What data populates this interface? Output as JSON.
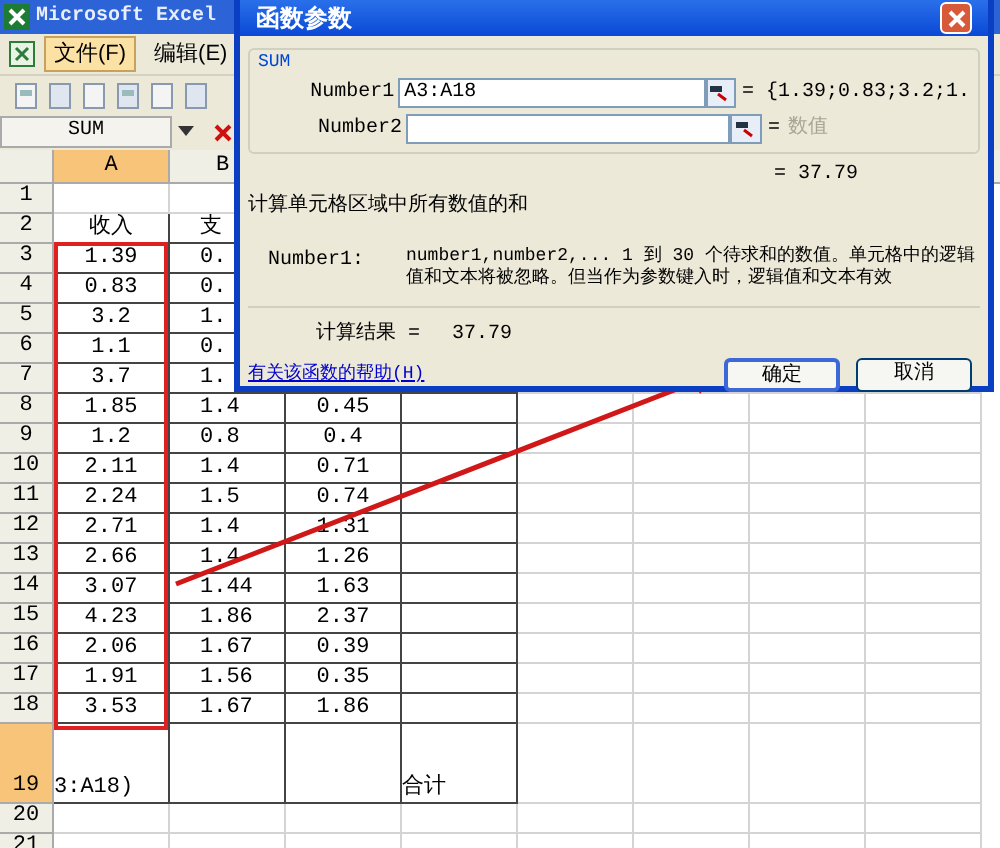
{
  "excel": {
    "title": "Microsoft Excel",
    "menus": [
      {
        "label": "文件(F)",
        "selected": true
      },
      {
        "label": "编辑(E)",
        "selected": false
      }
    ],
    "name_box": "SUM",
    "columns": [
      {
        "label": "A",
        "selected": true
      },
      {
        "label": "B",
        "selected": false
      }
    ],
    "rows": [
      {
        "header": "1",
        "selected": false,
        "cells": [
          null,
          null,
          null,
          null
        ]
      },
      {
        "header": "2",
        "selected": false,
        "cells": [
          "收入",
          "支",
          null,
          null
        ]
      },
      {
        "header": "3",
        "selected": false,
        "cells": [
          "1.39",
          "0.",
          null,
          null
        ]
      },
      {
        "header": "4",
        "selected": false,
        "cells": [
          "0.83",
          "0.",
          null,
          null
        ]
      },
      {
        "header": "5",
        "selected": false,
        "cells": [
          "3.2",
          "1.",
          null,
          null
        ]
      },
      {
        "header": "6",
        "selected": false,
        "cells": [
          "1.1",
          "0.",
          null,
          null
        ]
      },
      {
        "header": "7",
        "selected": false,
        "cells": [
          "3.7",
          "1.",
          null,
          null
        ]
      },
      {
        "header": "8",
        "selected": false,
        "cells": [
          "1.85",
          "1.4",
          "0.45",
          null
        ]
      },
      {
        "header": "9",
        "selected": false,
        "cells": [
          "1.2",
          "0.8",
          "0.4",
          null
        ]
      },
      {
        "header": "10",
        "selected": false,
        "cells": [
          "2.11",
          "1.4",
          "0.71",
          null
        ]
      },
      {
        "header": "11",
        "selected": false,
        "cells": [
          "2.24",
          "1.5",
          "0.74",
          null
        ]
      },
      {
        "header": "12",
        "selected": false,
        "cells": [
          "2.71",
          "1.4",
          "1.31",
          null
        ]
      },
      {
        "header": "13",
        "selected": false,
        "cells": [
          "2.66",
          "1.4",
          "1.26",
          null
        ]
      },
      {
        "header": "14",
        "selected": false,
        "cells": [
          "3.07",
          "1.44",
          "1.63",
          null
        ]
      },
      {
        "header": "15",
        "selected": false,
        "cells": [
          "4.23",
          "1.86",
          "2.37",
          null
        ]
      },
      {
        "header": "16",
        "selected": false,
        "cells": [
          "2.06",
          "1.67",
          "0.39",
          null
        ]
      },
      {
        "header": "17",
        "selected": false,
        "cells": [
          "1.91",
          "1.56",
          "0.35",
          null
        ]
      },
      {
        "header": "18",
        "selected": false,
        "cells": [
          "3.53",
          "1.67",
          "1.86",
          null
        ]
      },
      {
        "header": "19",
        "selected": true,
        "cells": [
          "3:A18)",
          null,
          null,
          "合计"
        ]
      },
      {
        "header": "20",
        "selected": false,
        "cells": [
          null,
          null,
          null,
          null
        ]
      },
      {
        "header": "21",
        "selected": false,
        "cells": [
          null,
          null,
          null,
          null
        ]
      }
    ]
  },
  "dialog": {
    "title": "函数参数",
    "function_name": "SUM",
    "arguments": [
      {
        "label": "Number1",
        "value": "A3:A18",
        "result": "= {1.39;0.83;3.2;1."
      },
      {
        "label": "Number2",
        "placeholder": "数值",
        "result": "="
      }
    ],
    "formula_result": "= 37.79",
    "description": "计算单元格区域中所有数值的和",
    "argument_label": "Number1:",
    "argument_help": "number1,number2,... 1 到 30 个待求和的数值。单元格中的逻辑值和文本将被忽略。但当作为参数键入时，逻辑值和文本有效",
    "result_label": "计算结果 =",
    "result_value": "37.79",
    "help_link": "有关该函数的帮助(H)",
    "buttons": [
      {
        "label": "确定",
        "selected": true
      },
      {
        "label": "取消",
        "selected": false
      }
    ]
  }
}
